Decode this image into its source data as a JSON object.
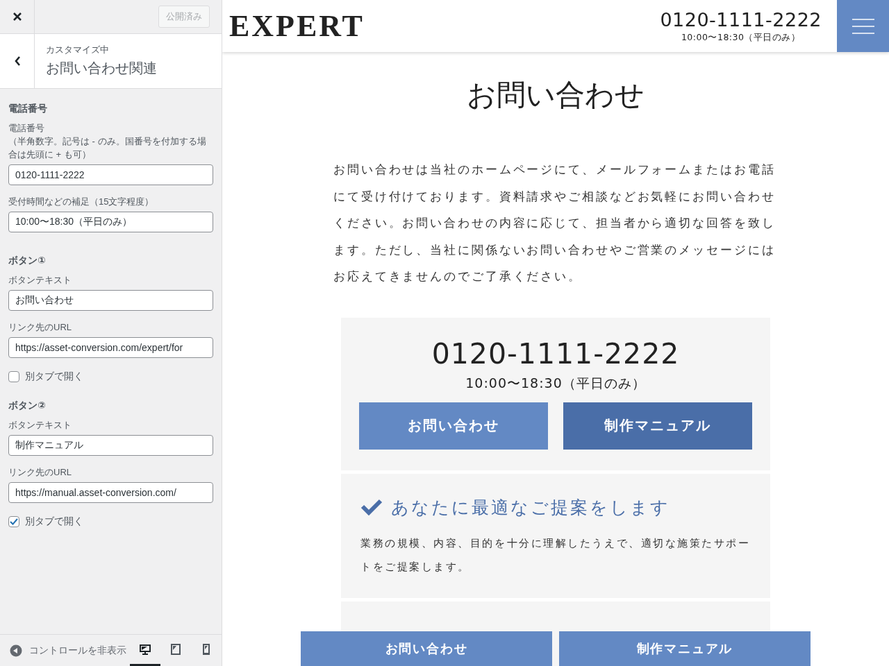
{
  "sidebar": {
    "publish_button": {
      "label": "公開済み",
      "disabled": true
    },
    "header": {
      "subtitle": "カスタマイズ中",
      "title": "お問い合わせ関連"
    },
    "sections": [
      {
        "heading": "電話番号",
        "fields": [
          {
            "kind": "text",
            "label": "電話番号",
            "hint": "（半角数字。記号は - のみ。国番号を付加する場合は先頭に + も可）",
            "value": "0120-1111-2222"
          },
          {
            "kind": "text",
            "label": "受付時間などの補足（15文字程度）",
            "value": "10:00〜18:30（平日のみ）"
          }
        ]
      },
      {
        "heading": "ボタン①",
        "fields": [
          {
            "kind": "text",
            "label": "ボタンテキスト",
            "value": "お問い合わせ"
          },
          {
            "kind": "text",
            "label": "リンク先のURL",
            "value": "https://asset-conversion.com/expert/for"
          },
          {
            "kind": "checkbox",
            "label": "別タブで開く",
            "checked": false
          }
        ]
      },
      {
        "heading": "ボタン②",
        "fields": [
          {
            "kind": "text",
            "label": "ボタンテキスト",
            "value": "制作マニュアル"
          },
          {
            "kind": "text",
            "label": "リンク先のURL",
            "value": "https://manual.asset-conversion.com/"
          },
          {
            "kind": "checkbox",
            "label": "別タブで開く",
            "checked": true
          }
        ]
      }
    ],
    "footer": {
      "collapse_label": "コントロールを非表示",
      "devices": [
        {
          "kind": "desktop",
          "selected": true
        },
        {
          "kind": "tablet",
          "selected": false
        },
        {
          "kind": "mobile",
          "selected": false
        }
      ]
    }
  },
  "preview": {
    "header": {
      "logo": "EXPERT",
      "phone": "0120-1111-2222",
      "hours": "10:00〜18:30（平日のみ）"
    },
    "title": "お問い合わせ",
    "intro": "お問い合わせは当社のホームページにて、メールフォームまたはお電話にて受け付けております。資料請求やご相談などお気軽にお問い合わせください。お問い合わせの内容に応じて、担当者から適切な回答を致します。ただし、当社に関係ないお問い合わせやご営業のメッセージにはお応えてきませんのでご了承ください。",
    "contact": {
      "phone": "0120-1111-2222",
      "hours": "10:00〜18:30（平日のみ）",
      "buttons": [
        {
          "label": "お問い合わせ",
          "kind": "primary"
        },
        {
          "label": "制作マニュアル",
          "kind": "secondary"
        }
      ]
    },
    "features": [
      {
        "title": "あなたに最適なご提案をします",
        "text": "業務の規模、内容、目的を十分に理解したうえで、適切な施策たサポートをご提案します。"
      }
    ],
    "bottom_bar": [
      "お問い合わせ",
      "制作マニュアル"
    ]
  }
}
